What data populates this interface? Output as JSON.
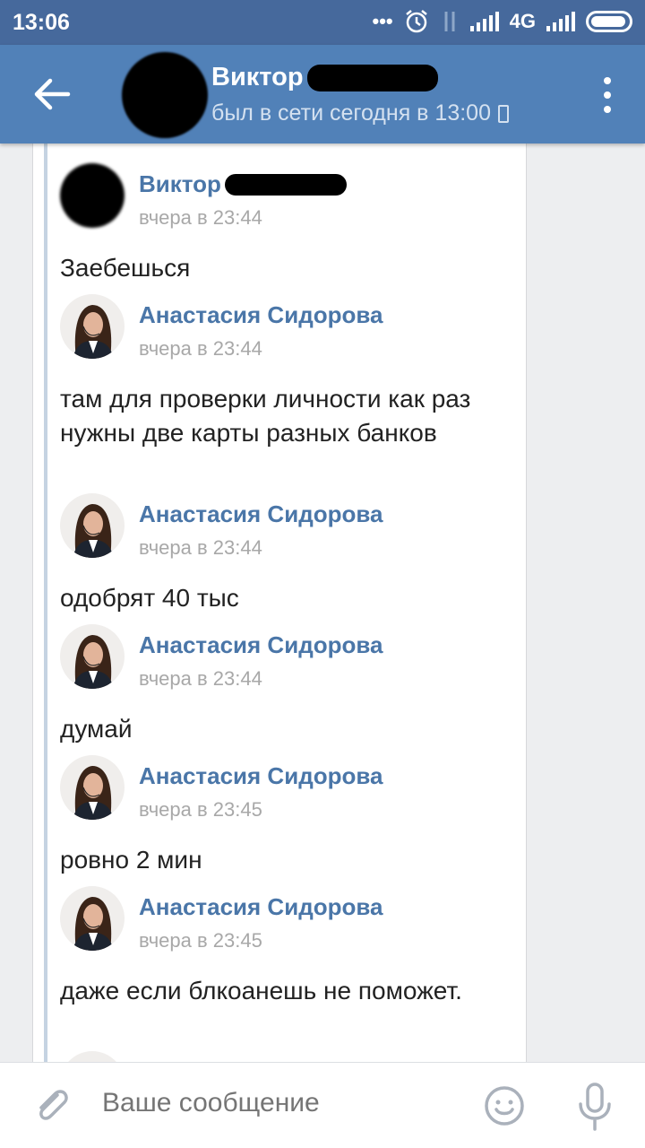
{
  "status_bar": {
    "time": "13:06",
    "dots": "•••",
    "network": "4G"
  },
  "header": {
    "contact_name": "Виктор",
    "last_seen": "был в сети сегодня в 13:00"
  },
  "messages": [
    {
      "author": "Виктор",
      "time": "вчера в 23:44",
      "text": "Заебешься"
    },
    {
      "author": "Анастасия Сидорова",
      "time": "вчера в 23:44",
      "text": "там для проверки личности как раз нужны две карты разных банков"
    },
    {
      "author": "Анастасия Сидорова",
      "time": "вчера в 23:44",
      "text": "одобрят 40 тыс"
    },
    {
      "author": "Анастасия Сидорова",
      "time": "вчера в 23:44",
      "text": "думай"
    },
    {
      "author": "Анастасия Сидорова",
      "time": "вчера в 23:45",
      "text": "ровно 2 мин"
    },
    {
      "author": "Анастасия Сидорова",
      "time": "вчера в 23:45",
      "text": "даже если блкоанешь не поможет."
    }
  ],
  "composer": {
    "placeholder": "Ваше сообщение"
  },
  "colors": {
    "header": "#5181b8",
    "status_bar": "#46699c",
    "author_link": "#4a76a8"
  }
}
